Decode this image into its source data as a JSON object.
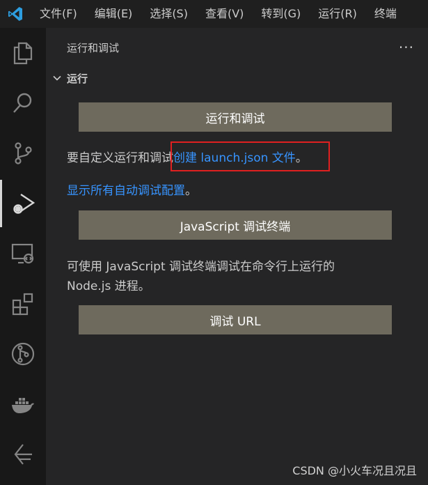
{
  "menu": {
    "items": [
      "文件(F)",
      "编辑(E)",
      "选择(S)",
      "查看(V)",
      "转到(G)",
      "运行(R)",
      "终端"
    ]
  },
  "activity_bar": {
    "icons": [
      "explorer-icon",
      "search-icon",
      "source-control-icon",
      "run-debug-icon",
      "remote-explorer-icon",
      "extensions-icon",
      "git-graph-icon",
      "docker-icon",
      "timeline-icon"
    ],
    "active": "run-debug-icon"
  },
  "sidebar": {
    "title": "运行和调试",
    "more": "···",
    "section": {
      "title": "运行"
    },
    "run_debug_button": "运行和调试",
    "customize_prefix": "要自定义运行和调试",
    "create_launch_link": "创建 launch.json 文件",
    "customize_suffix": "。",
    "show_configs_link": "显示所有自动调试配置",
    "show_configs_suffix": "。",
    "js_terminal_button": "JavaScript 调试终端",
    "js_desc_line1": "可使用 JavaScript 调试终端调试在命令行上运行的",
    "js_desc_line2": "Node.js 进程。",
    "debug_url_button": "调试 URL"
  },
  "watermark": "CSDN @小火车况且况且",
  "colors": {
    "background": "#1f1f1f",
    "sidebar": "#252526",
    "activity_bar": "#181818",
    "button": "#6e6a5d",
    "link": "#3794ff",
    "highlight": "#e02020",
    "logo": "#2d9ee0"
  }
}
